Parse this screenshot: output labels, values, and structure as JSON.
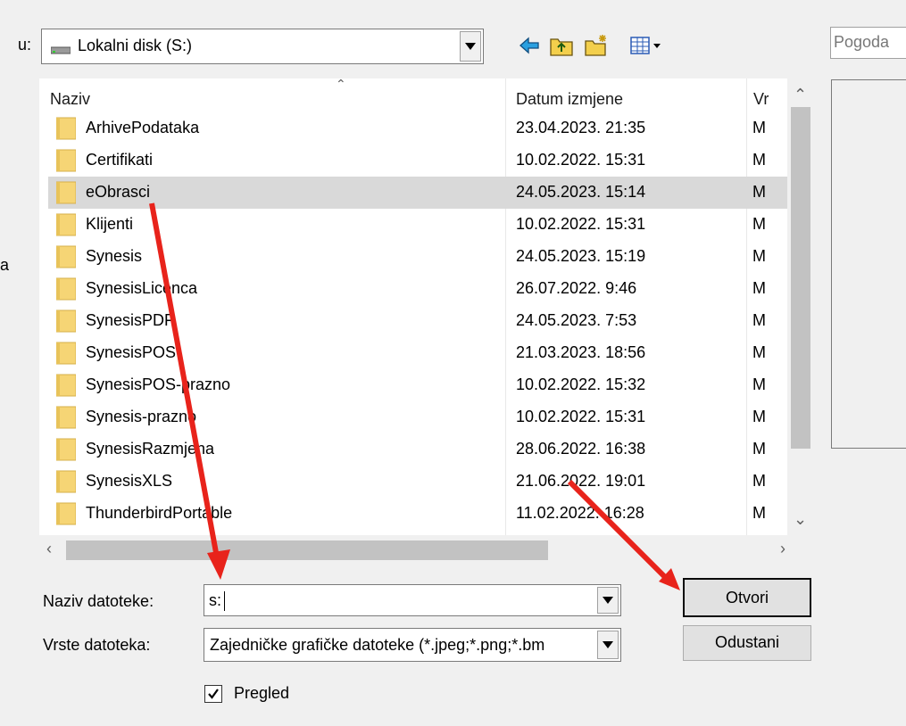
{
  "lookin": {
    "label": "u:",
    "value": "Lokalni disk (S:)"
  },
  "search": {
    "placeholder": "Pogoda"
  },
  "sidebar": {
    "fragment": "a"
  },
  "list": {
    "columns": {
      "name": "Naziv",
      "date": "Datum izmjene",
      "type": "Vr"
    },
    "rows": [
      {
        "name": "ArhivePodataka",
        "date": "23.04.2023. 21:35",
        "type": "M"
      },
      {
        "name": "Certifikati",
        "date": "10.02.2022. 15:31",
        "type": "M"
      },
      {
        "name": "eObrasci",
        "date": "24.05.2023. 15:14",
        "type": "M"
      },
      {
        "name": "Klijenti",
        "date": "10.02.2022. 15:31",
        "type": "M"
      },
      {
        "name": "Synesis",
        "date": "24.05.2023. 15:19",
        "type": "M"
      },
      {
        "name": "SynesisLicenca",
        "date": "26.07.2022. 9:46",
        "type": "M"
      },
      {
        "name": "SynesisPDF",
        "date": "24.05.2023. 7:53",
        "type": "M"
      },
      {
        "name": "SynesisPOS",
        "date": "21.03.2023. 18:56",
        "type": "M"
      },
      {
        "name": "SynesisPOS-prazno",
        "date": "10.02.2022. 15:32",
        "type": "M"
      },
      {
        "name": "Synesis-prazno",
        "date": "10.02.2022. 15:31",
        "type": "M"
      },
      {
        "name": "SynesisRazmjena",
        "date": "28.06.2022. 16:38",
        "type": "M"
      },
      {
        "name": "SynesisXLS",
        "date": "21.06.2022. 19:01",
        "type": "M"
      },
      {
        "name": "ThunderbirdPortable",
        "date": "11.02.2022. 16:28",
        "type": "M"
      }
    ],
    "selected_row": "eObrasci"
  },
  "filename": {
    "label": "Naziv datoteke:",
    "value": "s:"
  },
  "filetype": {
    "label": "Vrste datoteka:",
    "value": "Zajedničke grafičke datoteke (*.jpeg;*.png;*.bm"
  },
  "buttons": {
    "open": "Otvori",
    "cancel": "Odustani"
  },
  "preview": {
    "label": "Pregled",
    "checked": true
  },
  "colors": {
    "annotation_arrow": "#e8231b",
    "folder": "#f6d575",
    "selection": "#d9d9d9"
  },
  "icons": [
    "drive-icon",
    "back-arrow-icon",
    "up-folder-icon",
    "new-folder-icon",
    "view-menu-icon",
    "folder-icon",
    "checkmark-icon"
  ]
}
